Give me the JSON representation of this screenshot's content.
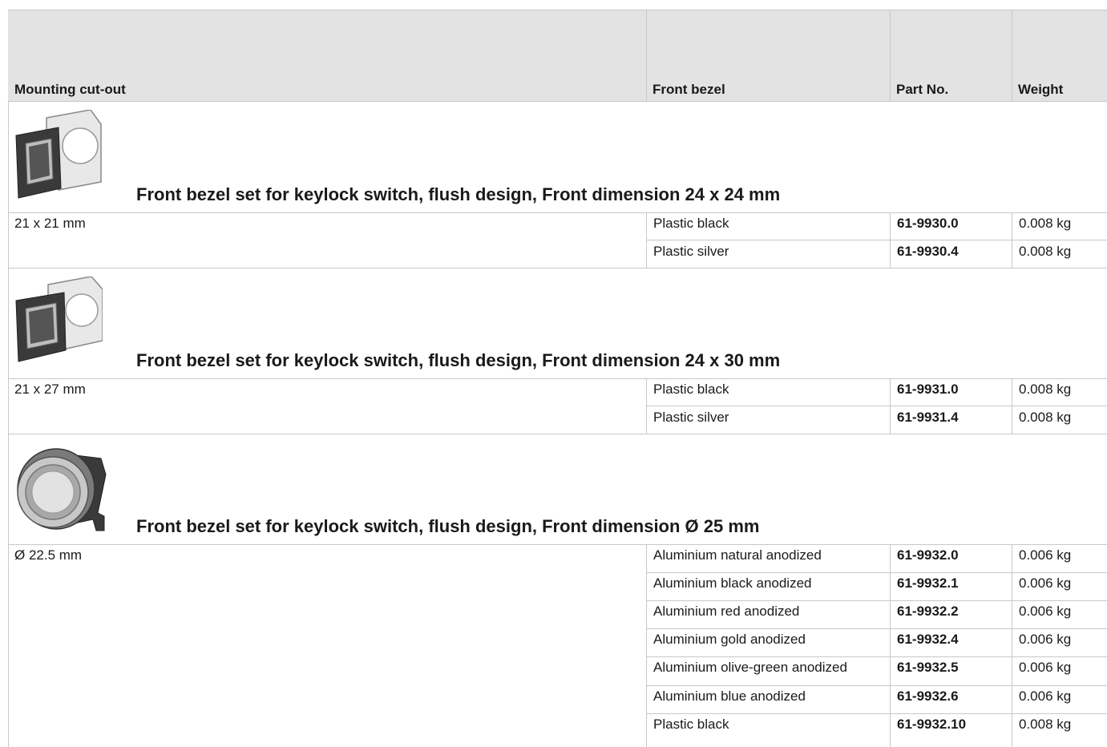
{
  "headers": {
    "cutout": "Mounting cut-out",
    "bezel": "Front bezel",
    "part": "Part No.",
    "weight": "Weight"
  },
  "groups": [
    {
      "title": "Front bezel set for keylock switch, flush design, Front dimension 24 x 24 mm",
      "icon": "square-bezel-icon",
      "cutout": "21 x 21 mm",
      "rows": [
        {
          "bezel": "Plastic black",
          "part": "61-9930.0",
          "weight": "0.008 kg"
        },
        {
          "bezel": "Plastic silver",
          "part": "61-9930.4",
          "weight": "0.008 kg"
        }
      ]
    },
    {
      "title": "Front bezel set for keylock switch, flush design, Front dimension 24 x 30 mm",
      "icon": "rectangular-bezel-icon",
      "cutout": "21 x 27 mm",
      "rows": [
        {
          "bezel": "Plastic black",
          "part": "61-9931.0",
          "weight": "0.008 kg"
        },
        {
          "bezel": "Plastic silver",
          "part": "61-9931.4",
          "weight": "0.008 kg"
        }
      ]
    },
    {
      "title": "Front bezel set for keylock switch, flush design, Front dimension Ø 25 mm",
      "icon": "round-bezel-icon",
      "cutout": "Ø 22.5 mm",
      "rows": [
        {
          "bezel": "Aluminium natural anodized",
          "part": "61-9932.0",
          "weight": "0.006 kg"
        },
        {
          "bezel": "Aluminium black anodized",
          "part": "61-9932.1",
          "weight": "0.006 kg"
        },
        {
          "bezel": "Aluminium red anodized",
          "part": "61-9932.2",
          "weight": "0.006 kg"
        },
        {
          "bezel": "Aluminium gold anodized",
          "part": "61-9932.4",
          "weight": "0.006 kg"
        },
        {
          "bezel": "Aluminium olive-green anodized",
          "part": "61-9932.5",
          "weight": "0.006 kg"
        },
        {
          "bezel": "Aluminium blue anodized",
          "part": "61-9932.6",
          "weight": "0.006 kg"
        },
        {
          "bezel": "Plastic black",
          "part": "61-9932.10",
          "weight": "0.008 kg"
        }
      ]
    }
  ]
}
